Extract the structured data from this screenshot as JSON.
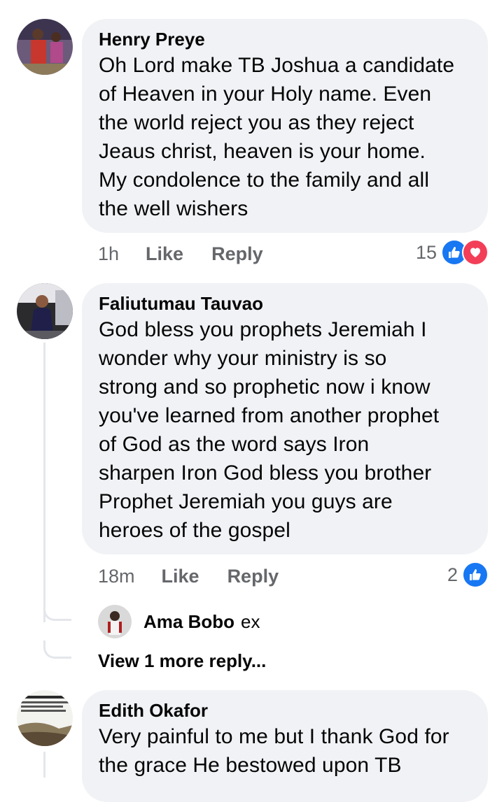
{
  "comments": [
    {
      "author": "Henry Preye",
      "text": "Oh Lord make TB Joshua a candidate\nof Heaven in your Holy name. Even\nthe world reject you as they reject\nJeaus christ, heaven is your home.\nMy condolence to the family and all\nthe well wishers",
      "time": "1h",
      "like_label": "Like",
      "reply_label": "Reply",
      "reaction_count": "15",
      "reactions": [
        "like-icon",
        "heart-icon"
      ]
    },
    {
      "author": "Faliutumau Tauvao",
      "text": "God bless you prophets Jeremiah  I\nwonder why your ministry is so\nstrong and so  prophetic now i know\nyou've learned  from another prophet\nof  God  as the word says Iron\nsharpen Iron God bless you brother\nProphet Jeremiah you guys are\nheroes of the gospel",
      "time": "18m",
      "like_label": "Like",
      "reply_label": "Reply",
      "reaction_count": "2",
      "reactions": [
        "like-icon"
      ],
      "reply_preview": {
        "author": "Ama Bobo",
        "snippet": "ex"
      },
      "more_replies_label": "View 1 more reply..."
    },
    {
      "author": "Edith Okafor",
      "text": "Very painful to me but I thank God for\nthe grace He bestowed upon TB"
    }
  ],
  "colors": {
    "bubble": "#f0f2f5",
    "meta_text": "#65676b",
    "like_blue": "#1877f2",
    "love_red": "#f33e58"
  }
}
